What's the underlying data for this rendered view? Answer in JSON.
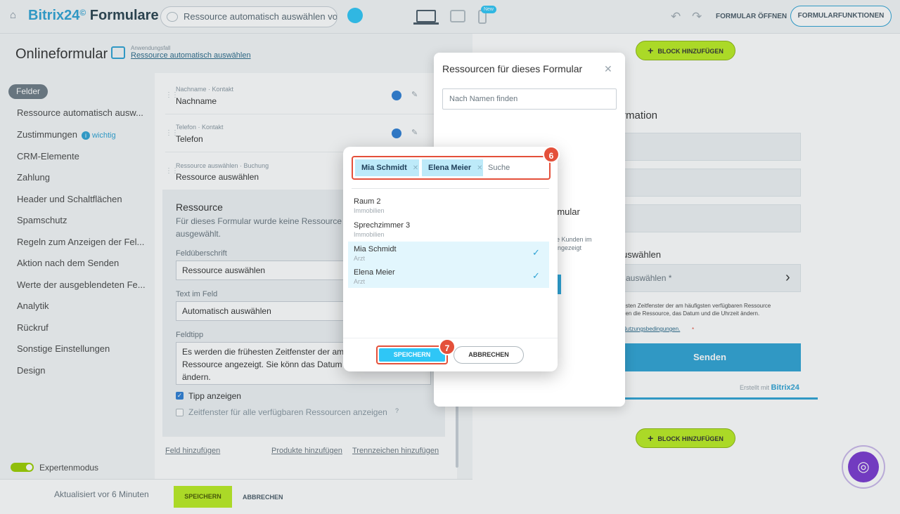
{
  "header": {
    "brand_main": "Bitrix24",
    "brand_sup": "©",
    "brand_suffix": " Formulare",
    "form_title": "Ressource automatisch auswählen vo...",
    "new_badge": "New",
    "open_form": "FORMULAR ÖFFNEN",
    "form_functions": "FORMULARFUNKTIONEN"
  },
  "page": {
    "title": "Onlineformular",
    "usecase_label": "Anwendungsfall",
    "usecase_link": "Ressource automatisch auswählen"
  },
  "sidebar": {
    "active": "Felder",
    "items": [
      "Ressource automatisch ausw...",
      "Zustimmungen",
      "CRM-Elemente",
      "Zahlung",
      "Header und Schaltflächen",
      "Spamschutz",
      "Regeln zum Anzeigen der Fel...",
      "Aktion nach dem Senden",
      "Werte der ausgeblendeten Fe...",
      "Analytik",
      "Rückruf",
      "Sonstige Einstellungen",
      "Design"
    ],
    "wichtig": "wichtig",
    "expert_mode": "Expertenmodus"
  },
  "editor": {
    "fields": [
      {
        "meta": "Nachname · Kontakt",
        "name": "Nachname"
      },
      {
        "meta": "Telefon · Kontakt",
        "name": "Telefon"
      },
      {
        "meta": "Ressource auswählen · Buchung",
        "name": "Ressource auswählen"
      }
    ],
    "resource": {
      "title": "Ressource",
      "desc": "Für dieses Formular wurde keine Ressource ausgewählt.",
      "heading_label": "Feldüberschrift",
      "heading_value": "Ressource auswählen",
      "text_label": "Text im Feld",
      "text_value": "Automatisch auswählen",
      "tip_label": "Feldtipp",
      "tip_value": "Es werden die frühesten Zeitfenster der am verfügbaren Ressource angezeigt. Sie könn das Datum und die Uhrzeit ändern.",
      "show_tip": "Tipp anzeigen",
      "show_all": "Zeitfenster für alle verfügbaren Ressourcen anzeigen"
    },
    "add_field": "Feld hinzufügen",
    "add_products": "Produkte hinzufügen",
    "add_separator": "Trennzeichen hinzufügen"
  },
  "bottom": {
    "updated": "Aktualisiert vor 6 Minuten",
    "save": "SPEICHERN",
    "cancel": "ABBRECHEN"
  },
  "preview": {
    "add_block": "BLOCK HINZUFÜGEN",
    "info_heading": "rmation",
    "select_heading": "uswählen",
    "select_placeholder": "auswählen *",
    "hint_line1": "esten Zeitfenster der am häufigsten verfügbaren Ressource",
    "hint_line2": "nen die Ressource, das Datum und die Uhrzeit ändern.",
    "terms": "Nutzungsbedingungen.",
    "send": "Senden",
    "made_with": "Erstellt mit",
    "made_brand": "Bitrix24"
  },
  "side_popup": {
    "title": "Ressourcen für dieses Formular",
    "search_placeholder": "Nach Namen finden",
    "text1": "rmular",
    "text2a": "re Kunden im",
    "text2b": "angezeigt"
  },
  "modal": {
    "tags": [
      "Mia Schmidt",
      "Elena Meier"
    ],
    "search_placeholder": "Suche",
    "options": [
      {
        "name": "Raum 2",
        "sub": "Immobilien",
        "selected": false
      },
      {
        "name": "Sprechzimmer 3",
        "sub": "Immobilien",
        "selected": false
      },
      {
        "name": "Mia Schmidt",
        "sub": "Arzt",
        "selected": true
      },
      {
        "name": "Elena Meier",
        "sub": "Arzt",
        "selected": true
      }
    ],
    "save": "SPEICHERN",
    "cancel": "ABBRECHEN"
  },
  "markers": [
    "6",
    "7"
  ],
  "colors": {
    "accent": "#2fa3d4",
    "green": "#bbed21",
    "marker": "#e4503a",
    "tag": "#bdeaf9"
  }
}
